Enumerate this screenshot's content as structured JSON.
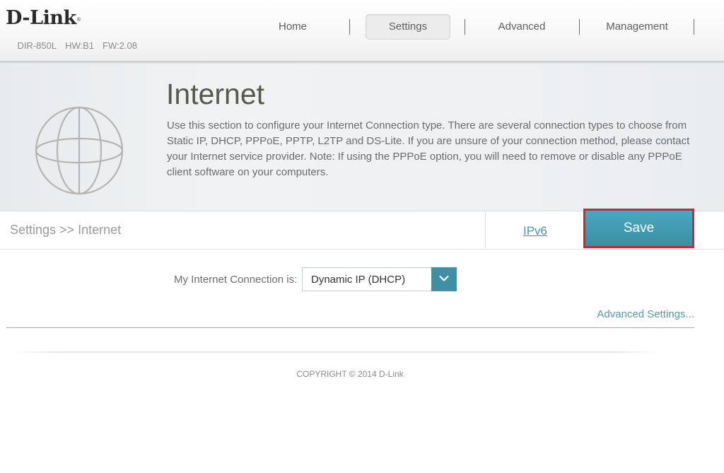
{
  "header": {
    "brand": "D-Link",
    "brand_mark": "®",
    "model": "DIR-850L",
    "hardware": "HW:B1",
    "firmware": "FW:2.08"
  },
  "nav": {
    "items": [
      {
        "label": "Home",
        "active": false
      },
      {
        "label": "Settings",
        "active": true
      },
      {
        "label": "Advanced",
        "active": false
      },
      {
        "label": "Management",
        "active": false
      }
    ]
  },
  "banner": {
    "icon": "globe-icon",
    "title": "Internet",
    "description": "Use this section to configure your Internet Connection type. There are several connection types to choose from Static IP, DHCP, PPPoE, PPTP, L2TP and DS-Lite. If you are unsure of your connection method, please contact your Internet service provider. Note: If using the PPPoE option, you will need to remove or disable any PPPoE client software on your computers."
  },
  "toolbar": {
    "breadcrumb": "Settings >> Internet",
    "ipv6_link": "IPv6",
    "save_label": "Save"
  },
  "form": {
    "connection_label": "My Internet Connection is:",
    "connection_value": "Dynamic IP (DHCP)",
    "dropdown_icon": "chevron-down-icon",
    "advanced_settings_link": "Advanced Settings..."
  },
  "footer": {
    "copyright": "COPYRIGHT © 2014 D-Link"
  },
  "colors": {
    "accent": "#3f90a6",
    "save_button": "#429db5",
    "highlight_border": "#d6232e",
    "link": "#4f8fa0",
    "title": "#555a4a"
  }
}
